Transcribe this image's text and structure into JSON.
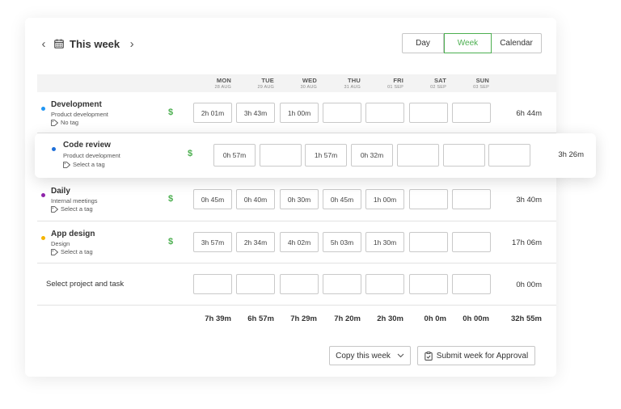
{
  "header": {
    "title": "This week",
    "views": [
      "Day",
      "Week",
      "Calendar"
    ],
    "active_view": "Week"
  },
  "days": [
    {
      "name": "MON",
      "date": "28 AUG"
    },
    {
      "name": "TUE",
      "date": "29 AUG"
    },
    {
      "name": "WED",
      "date": "30 AUG"
    },
    {
      "name": "THU",
      "date": "31 AUG"
    },
    {
      "name": "FRI",
      "date": "01 SEP"
    },
    {
      "name": "SAT",
      "date": "02 SEP"
    },
    {
      "name": "SUN",
      "date": "03 SEP"
    }
  ],
  "rows": [
    {
      "project": "Development",
      "client": "Product development",
      "tag": "No tag",
      "color": "#2196f3",
      "entries": [
        "2h 01m",
        "3h 43m",
        "1h 00m",
        "",
        "",
        "",
        ""
      ],
      "total": "6h 44m"
    },
    {
      "project": "Code review",
      "client": "Product development",
      "tag": "Select a tag",
      "color": "#1e6fd9",
      "entries": [
        "0h 57m",
        "",
        "1h 57m",
        "0h 32m",
        "",
        "",
        ""
      ],
      "total": "3h 26m"
    },
    {
      "project": "Daily",
      "client": "Internal meetings",
      "tag": "Select a tag",
      "color": "#8e24aa",
      "entries": [
        "0h 45m",
        "0h 40m",
        "0h 30m",
        "0h 45m",
        "1h 00m",
        "",
        ""
      ],
      "total": "3h 40m"
    },
    {
      "project": "App design",
      "client": "Design",
      "tag": "Select a tag",
      "color": "#f5b400",
      "entries": [
        "3h 57m",
        "2h 34m",
        "4h 02m",
        "5h 03m",
        "1h 30m",
        "",
        ""
      ],
      "total": "17h 06m"
    }
  ],
  "new_row": {
    "label": "Select project and task",
    "total": "0h 00m"
  },
  "day_totals": [
    "7h 39m",
    "6h 57m",
    "7h 29m",
    "7h 20m",
    "2h 30m",
    "0h 0m",
    "0h 00m"
  ],
  "grand_total": "32h 55m",
  "footer": {
    "copy_label": "Copy this week",
    "submit_label": "Submit week for Approval"
  },
  "billable_symbol": "$"
}
